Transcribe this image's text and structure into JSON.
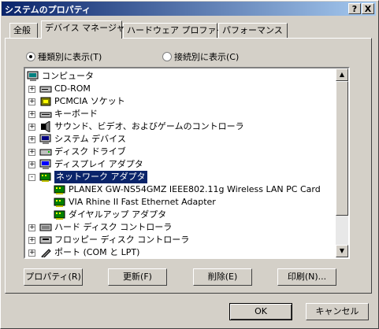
{
  "window": {
    "title": "システムのプロパティ",
    "help_btn": "?",
    "close_btn": "X"
  },
  "tabs": [
    "全般",
    "デバイス マネージャ",
    "ハードウェア プロファイル",
    "パフォーマンス"
  ],
  "view": {
    "by_type": "種類別に表示(T)",
    "by_connection": "接続別に表示(C)",
    "selected": "by_type"
  },
  "tree": [
    {
      "label": "コンピュータ",
      "icon": "computer-icon",
      "level": 0,
      "expander": ""
    },
    {
      "label": "CD-ROM",
      "icon": "cdrom-icon",
      "level": 1,
      "expander": "+"
    },
    {
      "label": "PCMCIA ソケット",
      "icon": "pcmcia-icon",
      "level": 1,
      "expander": "+"
    },
    {
      "label": "キーボード",
      "icon": "keyboard-icon",
      "level": 1,
      "expander": "+"
    },
    {
      "label": "サウンド、ビデオ、およびゲームのコントローラ",
      "icon": "sound-icon",
      "level": 1,
      "expander": "+"
    },
    {
      "label": "システム デバイス",
      "icon": "system-device-icon",
      "level": 1,
      "expander": "+"
    },
    {
      "label": "ディスク ドライブ",
      "icon": "disk-drive-icon",
      "level": 1,
      "expander": "+"
    },
    {
      "label": "ディスプレイ アダプタ",
      "icon": "display-icon",
      "level": 1,
      "expander": "+"
    },
    {
      "label": "ネットワーク アダプタ",
      "icon": "network-icon",
      "level": 1,
      "expander": "-",
      "selected": true
    },
    {
      "label": "PLANEX GW-NS54GMZ IEEE802.11g Wireless LAN PC Card",
      "icon": "network-icon",
      "level": 2,
      "expander": ""
    },
    {
      "label": "VIA Rhine II Fast Ethernet Adapter",
      "icon": "network-icon",
      "level": 2,
      "expander": ""
    },
    {
      "label": "ダイヤルアップ アダプタ",
      "icon": "network-icon",
      "level": 2,
      "expander": ""
    },
    {
      "label": "ハード ディスク コントローラ",
      "icon": "hdd-controller-icon",
      "level": 1,
      "expander": "+"
    },
    {
      "label": "フロッピー ディスク コントローラ",
      "icon": "floppy-controller-icon",
      "level": 1,
      "expander": "+"
    },
    {
      "label": "ポート (COM と LPT)",
      "icon": "port-icon",
      "level": 1,
      "expander": "+"
    }
  ],
  "actions": {
    "properties": "プロパティ(R)",
    "refresh": "更新(F)",
    "remove": "削除(E)",
    "print": "印刷(N)..."
  },
  "footer": {
    "ok": "OK",
    "cancel": "キャンセル"
  },
  "colors": {
    "selection": "#0a246a",
    "title_start": "#0a246a",
    "title_end": "#a6caf0"
  }
}
